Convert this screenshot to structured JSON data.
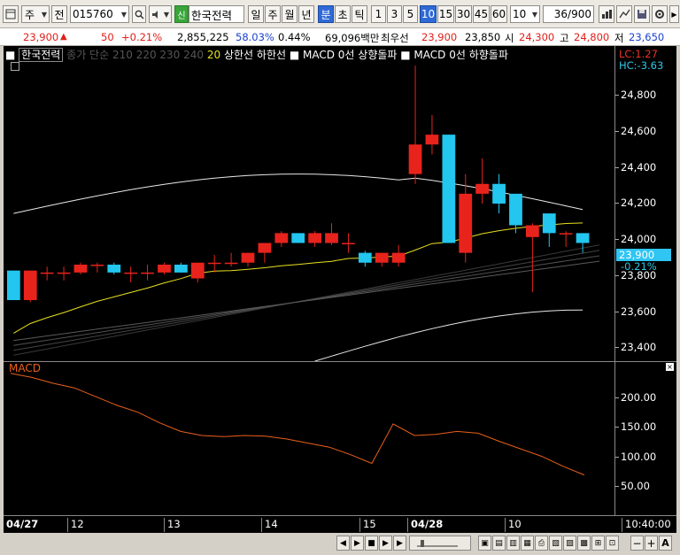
{
  "toolbar": {
    "type_label": "주",
    "prev_label": "전",
    "code": "015760",
    "new_badge": "신",
    "stock_name": "한국전력",
    "periods": [
      "일",
      "주",
      "월",
      "년",
      "분",
      "초",
      "틱"
    ],
    "active_period": "분",
    "intervals": [
      "1",
      "3",
      "5",
      "10",
      "15",
      "30",
      "45",
      "60"
    ],
    "active_interval": "10",
    "interval_select": "10",
    "count": "36",
    "count_max": "/900"
  },
  "quote": {
    "price": "23,900",
    "change": "50",
    "change_pct": "+0.21%",
    "volume": "2,855,225",
    "vol_ratio": "58.03%",
    "turnover_ratio": "0.44%",
    "amount": "69,096백만",
    "best_ask_label": "최우선",
    "best_ask": "23,900",
    "best_bid": "23,850",
    "open_label": "시",
    "open": "24,300",
    "high_label": "고",
    "high": "24,800",
    "low_label": "저",
    "low": "23,650"
  },
  "legend": {
    "name": "한국전력",
    "ma_label": "종가 단순",
    "ma_periods": "210  220  230  240",
    "ma20": "20",
    "bands": "상한선  하한선",
    "macd_up": "■ MACD 0선 상향돌파",
    "macd_down": "■ MACD 0선 하향돌파"
  },
  "price_axis": {
    "lc": "LC:1.27",
    "hc": "HC:-3.63",
    "ticks": [
      "24,800",
      "24,600",
      "24,400",
      "24,200",
      "24,000",
      "23,800",
      "23,600",
      "23,400"
    ],
    "current": "23,900",
    "current_pct": "-0.21%"
  },
  "macd": {
    "label": "MACD",
    "ticks": [
      "200.00",
      "150.00",
      "100.00",
      "50.00"
    ]
  },
  "time_axis": {
    "labels": [
      "04/27",
      "12",
      "13",
      "14",
      "15",
      "04/28",
      "10"
    ],
    "clock": "10:40:00"
  },
  "colors": {
    "up": "#e8231c",
    "down": "#22c6ee",
    "macd": "#e8601a",
    "ma20": "#e8e020",
    "bands": "#e8e8e8"
  },
  "chart_data": {
    "type": "candlestick",
    "candles": [
      {
        "o": 23760,
        "h": 23760,
        "l": 23610,
        "c": 23610
      },
      {
        "o": 23610,
        "h": 23760,
        "l": 23600,
        "c": 23760
      },
      {
        "o": 23750,
        "h": 23780,
        "l": 23710,
        "c": 23750
      },
      {
        "o": 23750,
        "h": 23780,
        "l": 23710,
        "c": 23750
      },
      {
        "o": 23750,
        "h": 23800,
        "l": 23740,
        "c": 23790
      },
      {
        "o": 23790,
        "h": 23800,
        "l": 23750,
        "c": 23790
      },
      {
        "o": 23790,
        "h": 23800,
        "l": 23740,
        "c": 23750
      },
      {
        "o": 23750,
        "h": 23780,
        "l": 23700,
        "c": 23750
      },
      {
        "o": 23750,
        "h": 23790,
        "l": 23710,
        "c": 23750
      },
      {
        "o": 23750,
        "h": 23800,
        "l": 23740,
        "c": 23790
      },
      {
        "o": 23790,
        "h": 23800,
        "l": 23750,
        "c": 23750
      },
      {
        "o": 23720,
        "h": 23800,
        "l": 23700,
        "c": 23800
      },
      {
        "o": 23800,
        "h": 23840,
        "l": 23750,
        "c": 23800
      },
      {
        "o": 23800,
        "h": 23850,
        "l": 23780,
        "c": 23800
      },
      {
        "o": 23800,
        "h": 23850,
        "l": 23780,
        "c": 23850
      },
      {
        "o": 23850,
        "h": 23900,
        "l": 23800,
        "c": 23900
      },
      {
        "o": 23900,
        "h": 23960,
        "l": 23880,
        "c": 23950
      },
      {
        "o": 23950,
        "h": 23950,
        "l": 23900,
        "c": 23900
      },
      {
        "o": 23900,
        "h": 23960,
        "l": 23880,
        "c": 23950
      },
      {
        "o": 23900,
        "h": 24000,
        "l": 23890,
        "c": 23950
      },
      {
        "o": 23900,
        "h": 23950,
        "l": 23850,
        "c": 23900
      },
      {
        "o": 23850,
        "h": 23860,
        "l": 23780,
        "c": 23800
      },
      {
        "o": 23800,
        "h": 23850,
        "l": 23780,
        "c": 23850
      },
      {
        "o": 23800,
        "h": 23890,
        "l": 23780,
        "c": 23850
      },
      {
        "o": 24250,
        "h": 24800,
        "l": 24200,
        "c": 24400
      },
      {
        "o": 24400,
        "h": 24550,
        "l": 24350,
        "c": 24450
      },
      {
        "o": 24450,
        "h": 24450,
        "l": 23900,
        "c": 23900
      },
      {
        "o": 23850,
        "h": 24250,
        "l": 23800,
        "c": 24150
      },
      {
        "o": 24150,
        "h": 24330,
        "l": 24100,
        "c": 24200
      },
      {
        "o": 24200,
        "h": 24250,
        "l": 24050,
        "c": 24100
      },
      {
        "o": 24150,
        "h": 24150,
        "l": 23950,
        "c": 23990
      },
      {
        "o": 23930,
        "h": 24000,
        "l": 23650,
        "c": 23990
      },
      {
        "o": 24050,
        "h": 24050,
        "l": 23880,
        "c": 23950
      },
      {
        "o": 23950,
        "h": 23960,
        "l": 23880,
        "c": 23950
      },
      {
        "o": 23950,
        "h": 23950,
        "l": 23850,
        "c": 23900
      }
    ],
    "macd_values": [
      235,
      228,
      218,
      210,
      195,
      180,
      168,
      150,
      135,
      128,
      126,
      128,
      127,
      122,
      115,
      108,
      95,
      80,
      148,
      128,
      130,
      135,
      132,
      118,
      105,
      92,
      75,
      60
    ],
    "yrange": [
      23300,
      24900
    ],
    "macd_range": [
      0,
      250
    ]
  }
}
